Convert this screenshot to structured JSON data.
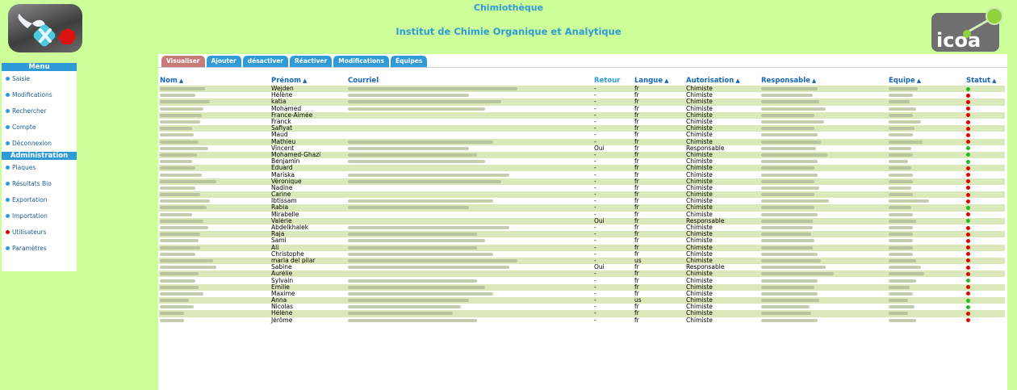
{
  "header": {
    "app_title": "Chimiothèque",
    "institute": "Institut de Chimie Organique et Analytique",
    "right_logo_text": "icoa"
  },
  "sidebar": {
    "menu_title": "Menu",
    "menu_items": [
      {
        "label": "Saisie"
      },
      {
        "label": "Modifications"
      },
      {
        "label": "Rechercher"
      },
      {
        "label": "Compte"
      },
      {
        "label": "Déconnexion"
      }
    ],
    "admin_title": "Administration",
    "admin_items": [
      {
        "label": "Plaques"
      },
      {
        "label": "Résultats Bio"
      },
      {
        "label": "Exportation"
      },
      {
        "label": "Importation"
      },
      {
        "label": "Utilisateurs",
        "active": true
      },
      {
        "label": "Paramètres"
      }
    ]
  },
  "tabs": [
    "Visualiser",
    "Ajouter",
    "désactiver",
    "Réactiver",
    "Modifications",
    "Équipes"
  ],
  "table": {
    "columns": [
      "Nom",
      "Prénom",
      "Courriel",
      "Retour",
      "Langue",
      "Autorisation",
      "Responsable",
      "Équipe",
      "Statut"
    ],
    "status_colors": {
      "green": "#22bb22",
      "red": "#e00000"
    },
    "rows": [
      {
        "prenom": "Wejden",
        "retour": "-",
        "langue": "fr",
        "auth": "Chimiste",
        "statut": "green"
      },
      {
        "prenom": "Hélène",
        "retour": "-",
        "langue": "fr",
        "auth": "Chimiste",
        "statut": "red"
      },
      {
        "prenom": "katia",
        "retour": "-",
        "langue": "fr",
        "auth": "Chimiste",
        "statut": "red"
      },
      {
        "prenom": "Mohamed",
        "retour": "-",
        "langue": "fr",
        "auth": "Chimiste",
        "statut": "red"
      },
      {
        "prenom": "France-Aimée",
        "retour": "-",
        "langue": "fr",
        "auth": "Chimiste",
        "statut": "red"
      },
      {
        "prenom": "Franck",
        "retour": "-",
        "langue": "fr",
        "auth": "Chimiste",
        "statut": "red"
      },
      {
        "prenom": "Safiyat",
        "retour": "-",
        "langue": "fr",
        "auth": "Chimiste",
        "statut": "red"
      },
      {
        "prenom": "Maud",
        "retour": "-",
        "langue": "fr",
        "auth": "Chimiste",
        "statut": "red"
      },
      {
        "prenom": "Mathieu",
        "retour": "-",
        "langue": "fr",
        "auth": "Chimiste",
        "statut": "red"
      },
      {
        "prenom": "Vincent",
        "retour": "Oui",
        "langue": "fr",
        "auth": "Responsable",
        "statut": "green"
      },
      {
        "prenom": "Mohamed-Ghazi",
        "retour": "-",
        "langue": "fr",
        "auth": "Chimiste",
        "statut": "green"
      },
      {
        "prenom": "Benjamin",
        "retour": "-",
        "langue": "fr",
        "auth": "Chimiste",
        "statut": "green"
      },
      {
        "prenom": "Eduard",
        "retour": "-",
        "langue": "fr",
        "auth": "Chimiste",
        "statut": "red"
      },
      {
        "prenom": "Mariska",
        "retour": "-",
        "langue": "fr",
        "auth": "Chimiste",
        "statut": "red"
      },
      {
        "prenom": "Véronique",
        "retour": "-",
        "langue": "fr",
        "auth": "Chimiste",
        "statut": "red"
      },
      {
        "prenom": "Nadine",
        "retour": "-",
        "langue": "fr",
        "auth": "Chimiste",
        "statut": "red"
      },
      {
        "prenom": "Carine",
        "retour": "-",
        "langue": "fr",
        "auth": "Chimiste",
        "statut": "red"
      },
      {
        "prenom": "Ibtissam",
        "retour": "-",
        "langue": "fr",
        "auth": "Chimiste",
        "statut": "red"
      },
      {
        "prenom": "Rabia",
        "retour": "-",
        "langue": "fr",
        "auth": "Chimiste",
        "statut": "green"
      },
      {
        "prenom": "Mirabelle",
        "retour": "-",
        "langue": "fr",
        "auth": "Chimiste",
        "statut": "red"
      },
      {
        "prenom": "Valérie",
        "retour": "Oui",
        "langue": "fr",
        "auth": "Responsable",
        "statut": "green"
      },
      {
        "prenom": "Abdelkhalek",
        "retour": "-",
        "langue": "fr",
        "auth": "Chimiste",
        "statut": "red"
      },
      {
        "prenom": "Raja",
        "retour": "-",
        "langue": "fr",
        "auth": "Chimiste",
        "statut": "red"
      },
      {
        "prenom": "Sami",
        "retour": "-",
        "langue": "fr",
        "auth": "Chimiste",
        "statut": "red"
      },
      {
        "prenom": "Ali",
        "retour": "-",
        "langue": "fr",
        "auth": "Chimiste",
        "statut": "red"
      },
      {
        "prenom": "Christophe",
        "retour": "-",
        "langue": "fr",
        "auth": "Chimiste",
        "statut": "red"
      },
      {
        "prenom": "maria del pilar",
        "retour": "-",
        "langue": "us",
        "auth": "Chimiste",
        "statut": "red"
      },
      {
        "prenom": "Sabine",
        "retour": "Oui",
        "langue": "fr",
        "auth": "Responsable",
        "statut": "red"
      },
      {
        "prenom": "Aurélie",
        "retour": "-",
        "langue": "fr",
        "auth": "Chimiste",
        "statut": "red"
      },
      {
        "prenom": "Sylvain",
        "retour": "-",
        "langue": "fr",
        "auth": "Chimiste",
        "statut": "green"
      },
      {
        "prenom": "Emilie",
        "retour": "-",
        "langue": "fr",
        "auth": "Chimiste",
        "statut": "red"
      },
      {
        "prenom": "Maxime",
        "retour": "-",
        "langue": "fr",
        "auth": "Chimiste",
        "statut": "red"
      },
      {
        "prenom": "Anna",
        "retour": "-",
        "langue": "us",
        "auth": "Chimiste",
        "statut": "green"
      },
      {
        "prenom": "Nicolas",
        "retour": "-",
        "langue": "fr",
        "auth": "Chimiste",
        "statut": "green"
      },
      {
        "prenom": "Hélène",
        "retour": "-",
        "langue": "fr",
        "auth": "Chimiste",
        "statut": "red"
      },
      {
        "prenom": "Jérôme",
        "retour": "-",
        "langue": "fr",
        "auth": "Chimiste",
        "statut": "red"
      }
    ]
  }
}
